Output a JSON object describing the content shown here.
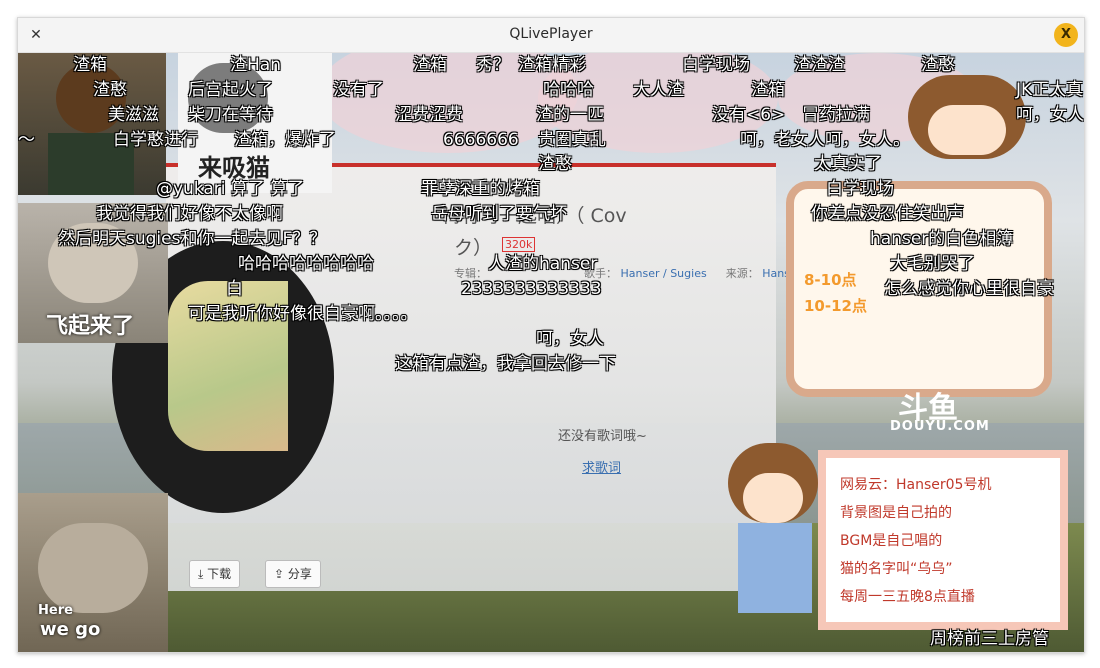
{
  "window": {
    "title": "QLivePlayer",
    "close_label": "✕",
    "app_icon_label": "X"
  },
  "player": {
    "song_title_line1": "梅竹马一起唱）（ Cov",
    "song_title_line2": "ク）",
    "hot_badge": "320k",
    "meta_album_label": "专辑：",
    "meta_singer_label": "歌手：",
    "meta_singer": "Hanser / Sugies",
    "meta_source_label": "来源：",
    "meta_source": "Hans",
    "no_lyrics": "还没有歌词哦~",
    "request_lyrics": "求歌词",
    "download_label": "下载",
    "share_label": "分享"
  },
  "stickers": {
    "top_left_text": "来吸猫",
    "left_middle_text": "飞起来了",
    "bottom_left_text1": "Here",
    "bottom_left_text2": "we go"
  },
  "notice_board": {
    "schedule_1": "8-10点",
    "schedule_2": "10-12点"
  },
  "douyu": {
    "logo": "斗鱼",
    "sub": "DOUYU.COM"
  },
  "note_card": {
    "line1": "网易云：Hanser05号机",
    "line2": "背景图是自己拍的",
    "line3": "BGM是自己唱的",
    "line4": "猫的名字叫“乌乌”",
    "line5": "每周一三五晚8点直播"
  },
  "danmaku": [
    {
      "text": "渣箱"
    },
    {
      "text": "渣Han"
    },
    {
      "text": "渣箱"
    },
    {
      "text": "秀？"
    },
    {
      "text": "渣箱精彩"
    },
    {
      "text": "白学现场"
    },
    {
      "text": "渣渣渣"
    },
    {
      "text": "渣憨"
    },
    {
      "text": "渣憨"
    },
    {
      "text": "后宫起火了"
    },
    {
      "text": "没有了"
    },
    {
      "text": "哈哈哈"
    },
    {
      "text": "大人渣"
    },
    {
      "text": "渣箱"
    },
    {
      "text": "JK正太真"
    },
    {
      "text": "美滋滋"
    },
    {
      "text": "柴刀在等待"
    },
    {
      "text": "涩费涩费"
    },
    {
      "text": "渣的一匹"
    },
    {
      "text": "没有<6>"
    },
    {
      "text": "冒药拉满"
    },
    {
      "text": "呵，女人"
    },
    {
      "text": "～"
    },
    {
      "text": "白学憨进行"
    },
    {
      "text": "渣箱，爆炸了"
    },
    {
      "text": "6666666"
    },
    {
      "text": "贵圈真乱"
    },
    {
      "text": "呵，老女人呵，女人。"
    },
    {
      "text": "渣憨"
    },
    {
      "text": "太真实了"
    },
    {
      "text": "@yukari 算了 算了"
    },
    {
      "text": "罪孽深重的烤箱"
    },
    {
      "text": "白学现场"
    },
    {
      "text": "我觉得我们好像不太像啊"
    },
    {
      "text": "岳母听到了要气坏"
    },
    {
      "text": "你差点没忍住笑出声"
    },
    {
      "text": "然后明天sugies和你一起去见F？？"
    },
    {
      "text": "hanser的白色相簿"
    },
    {
      "text": "哈哈哈哈哈哈哈哈"
    },
    {
      "text": "人渣的hanser"
    },
    {
      "text": "大毛别哭了"
    },
    {
      "text": "白"
    },
    {
      "text": "2333333333333"
    },
    {
      "text": "怎么感觉你心里很自豪"
    },
    {
      "text": "可是我听你好像很自豪啊。。。。"
    },
    {
      "text": "呵，女人"
    },
    {
      "text": "这箱有点渣，我拿回去修一下"
    },
    {
      "text": "周榜前三上房管"
    }
  ]
}
